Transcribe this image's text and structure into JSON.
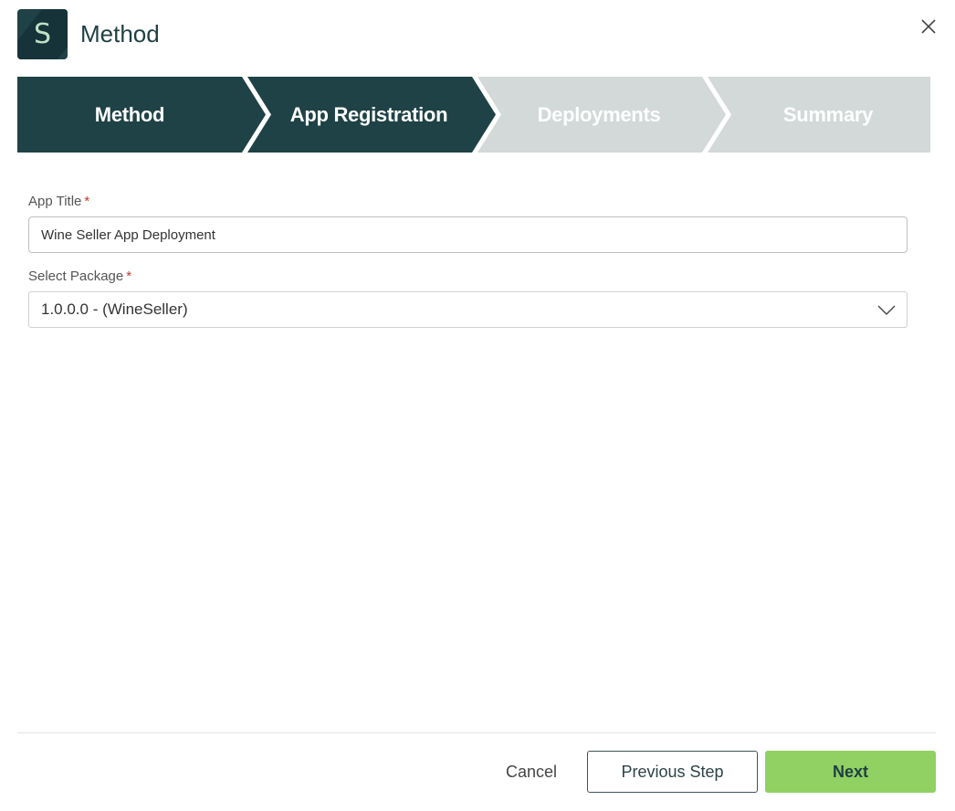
{
  "header": {
    "logo_letter": "S",
    "title": "Method",
    "close_icon": "close-icon"
  },
  "stepper": {
    "steps": [
      {
        "label": "Method",
        "state": "complete"
      },
      {
        "label": "App Registration",
        "state": "active"
      },
      {
        "label": "Deployments",
        "state": "inactive"
      },
      {
        "label": "Summary",
        "state": "inactive"
      }
    ],
    "active_color": "#1f4246",
    "inactive_color": "#d2d9d8"
  },
  "form": {
    "app_title": {
      "label": "App Title",
      "required_mark": "*",
      "value": "Wine Seller App Deployment"
    },
    "package": {
      "label": "Select Package",
      "required_mark": "*",
      "value": "1.0.0.0 - (WineSeller)",
      "icon": "chevron-down-icon"
    }
  },
  "footer": {
    "cancel_label": "Cancel",
    "previous_label": "Previous Step",
    "next_label": "Next",
    "next_color": "#91d063"
  }
}
